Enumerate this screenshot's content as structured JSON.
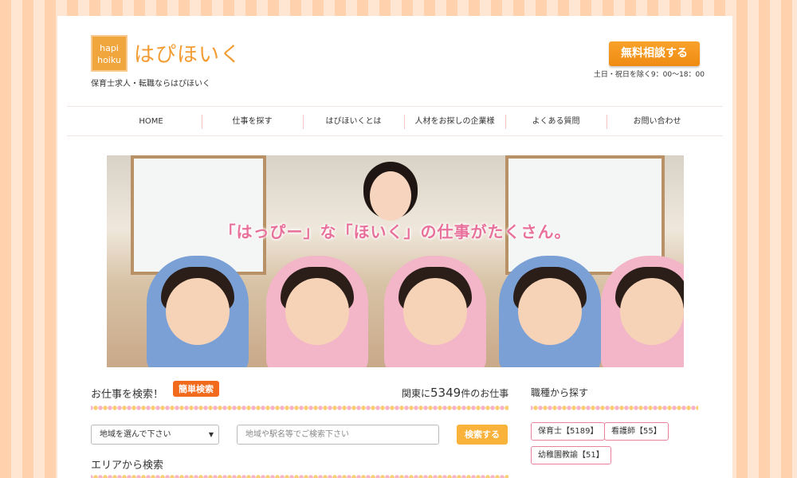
{
  "header": {
    "logo_box_line1": "hapi",
    "logo_box_line2": "hoiku",
    "logo_text": "はぴほいく",
    "tagline": "保育士求人・転職ならはぴほいく",
    "cta_label": "無料相談する",
    "hours": "土日・祝日を除く9：00〜18：00"
  },
  "nav": {
    "items": [
      {
        "label": "HOME"
      },
      {
        "label": "仕事を探す"
      },
      {
        "label": "はぴほいくとは"
      },
      {
        "label": "人材をお探しの企業様"
      },
      {
        "label": "よくある質問"
      },
      {
        "label": "お問い合わせ"
      }
    ]
  },
  "hero": {
    "caption": "「はっぴー」な「ほいく」の仕事がたくさん。"
  },
  "search": {
    "title": "お仕事を検索！",
    "badge": "簡単検索",
    "count_prefix": "関東に",
    "count_number": "5349",
    "count_suffix": "件のお仕事",
    "select_label": "地域を選んで下さい",
    "input_placeholder": "地域や駅名等でご検索下さい",
    "button_label": "検索する",
    "area_title": "エリアから検索"
  },
  "jobs": {
    "title": "職種から探す",
    "tags": [
      {
        "label": "保育士【5189】"
      },
      {
        "label": "看護師【55】"
      },
      {
        "label": "幼稚園教諭【51】"
      }
    ]
  },
  "colors": {
    "accent": "#f39c33",
    "cta": "#ef8b12",
    "badge": "#f26b1c",
    "caption_pink": "#e8719b"
  }
}
